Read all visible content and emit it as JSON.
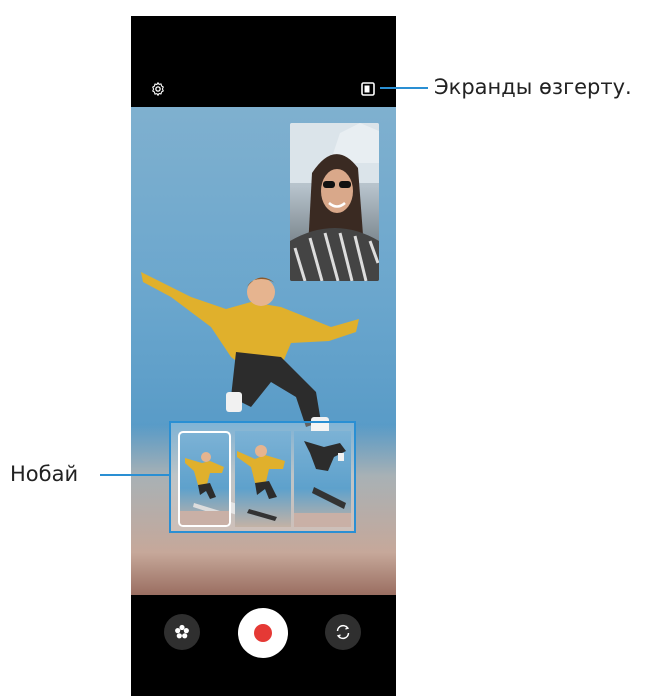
{
  "callouts": {
    "switch_screens": "Экранды өзгерту.",
    "option": "Нобай"
  },
  "icons": {
    "settings": "gear-icon",
    "screen_toggle": "picture-in-picture-icon",
    "effects": "flower-icon",
    "record": "record-icon",
    "flip": "camera-flip-icon"
  },
  "colors": {
    "accent": "#2a8fd3",
    "record": "#e53935"
  }
}
